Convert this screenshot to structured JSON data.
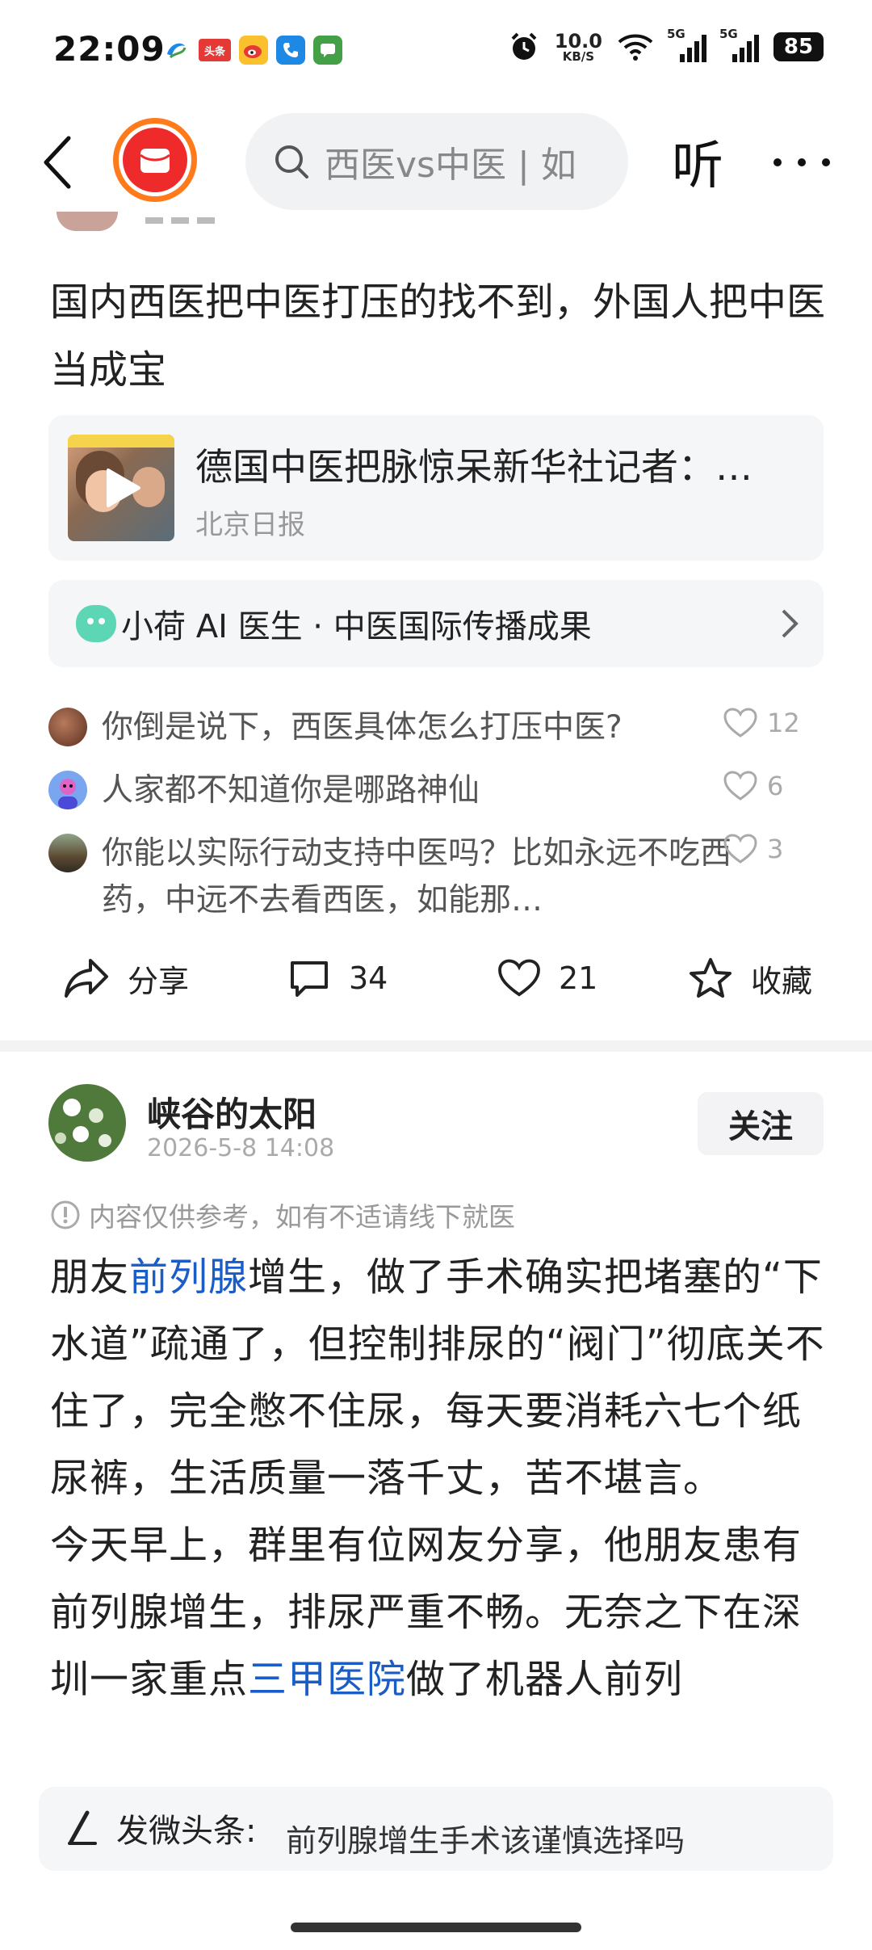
{
  "status_bar": {
    "time": "22:09",
    "toutiao_badge": "头条",
    "net_speed_value": "10.0",
    "net_speed_unit": "KB/S",
    "sim1_label": "5G",
    "sim2_label": "5G",
    "battery": "85"
  },
  "search": {
    "query": "西医vs中医 | 如"
  },
  "nav": {
    "listen_label": "听"
  },
  "post1": {
    "text": "国内西医把中医打压的找不到，外国人把中医当成宝",
    "link_card": {
      "title": "德国中医把脉惊呆新华社记者：…",
      "source": "北京日报"
    },
    "ai_bar": {
      "label": "小荷 AI 医生 · 中医国际传播成果"
    },
    "comments": [
      {
        "text": "你倒是说下，西医具体怎么打压中医?",
        "likes": "12"
      },
      {
        "text": "人家都不知道你是哪路神仙",
        "likes": "6"
      },
      {
        "text": "你能以实际行动支持中医吗？比如永远不吃西药，中远不去看西医，如能那…",
        "likes": "3"
      }
    ],
    "actions": {
      "share_label": "分享",
      "comment_count": "34",
      "like_count": "21",
      "favorite_label": "收藏"
    }
  },
  "post2": {
    "author": "峡谷的太阳",
    "time": "2026-5-8 14:08",
    "follow_label": "关注",
    "disclaimer": "内容仅供参考，如有不适请线下就医",
    "body_parts": {
      "p1a": "朋友",
      "link1": "前列腺",
      "p1b": "增生，做了手术确实把堵塞的“下水道”疏通了，但控制排尿的“阀门”彻底关不住了，完全憋不住尿，每天要消耗六七个纸尿裤，生活质量一落千丈，苦不堪言。",
      "p2a": "今天早上，群里有位网友分享，他朋友患有前列腺增生，排尿严重不畅。无奈之下在深圳一家重点",
      "link2": "三甲医院",
      "p2b": "做了机器人前列"
    }
  },
  "compose": {
    "label": "发微头条:",
    "text": "前列腺增生手术该谨慎选择吗"
  },
  "colors": {
    "link": "#1a5dc7",
    "logo_ring": "#ff7a1a",
    "logo_fill": "#ef2a2a",
    "ai_icon": "#5cd6b4"
  }
}
